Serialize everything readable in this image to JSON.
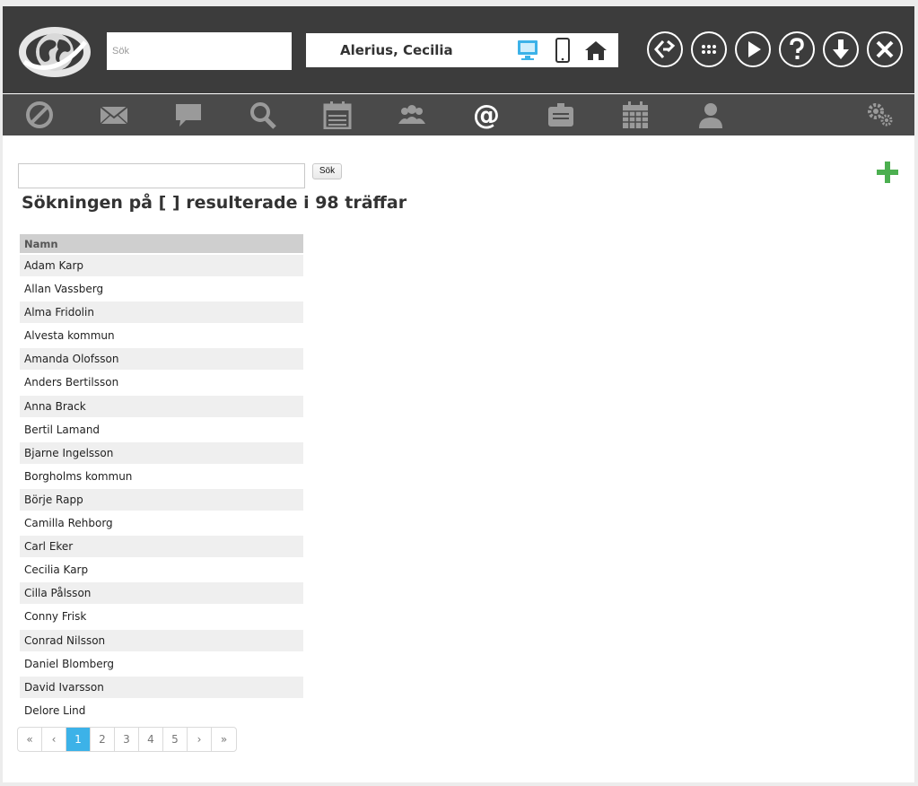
{
  "header": {
    "search_placeholder": "Sök",
    "user_name": "Alerius, Cecilia"
  },
  "main": {
    "search_button_label": "Sök",
    "result_title": "Sökningen på [ ] resulterade i 98 träffar",
    "table_header": "Namn",
    "rows": [
      "Adam Karp",
      "Allan Vassberg",
      "Alma Fridolin",
      "Alvesta kommun",
      "Amanda Olofsson",
      "Anders Bertilsson",
      "Anna Brack",
      "Bertil Lamand",
      "Bjarne Ingelsson",
      "Borgholms kommun",
      "Börje Rapp",
      "Camilla Rehborg",
      "Carl Eker",
      "Cecilia Karp",
      "Cilla Pålsson",
      "Conny Frisk",
      "Conrad Nilsson",
      "Daniel Blomberg",
      "David Ivarsson",
      "Delore Lind"
    ]
  },
  "pagination": {
    "first": "«",
    "prev": "‹",
    "pages": [
      "1",
      "2",
      "3",
      "4",
      "5"
    ],
    "current": "1",
    "next": "›",
    "last": "»"
  },
  "colors": {
    "header_bg": "#3c3c3c",
    "toolbar_bg": "#4a4a4a",
    "accent_blue": "#3cb2e8",
    "add_green": "#4caf50"
  },
  "icons": {
    "user_box": [
      "desktop-icon",
      "mobile-icon",
      "home-icon"
    ],
    "round_buttons": [
      "switch-icon",
      "apps-grid-icon",
      "play-icon",
      "help-icon",
      "download-icon",
      "close-icon"
    ],
    "toolbar": [
      "blocked-icon",
      "mail-icon",
      "chat-icon",
      "search-icon",
      "calendar-icon",
      "group-icon",
      "at-icon",
      "clipboard-icon",
      "calendar-grid-icon",
      "person-icon",
      "settings-gears-icon"
    ]
  }
}
